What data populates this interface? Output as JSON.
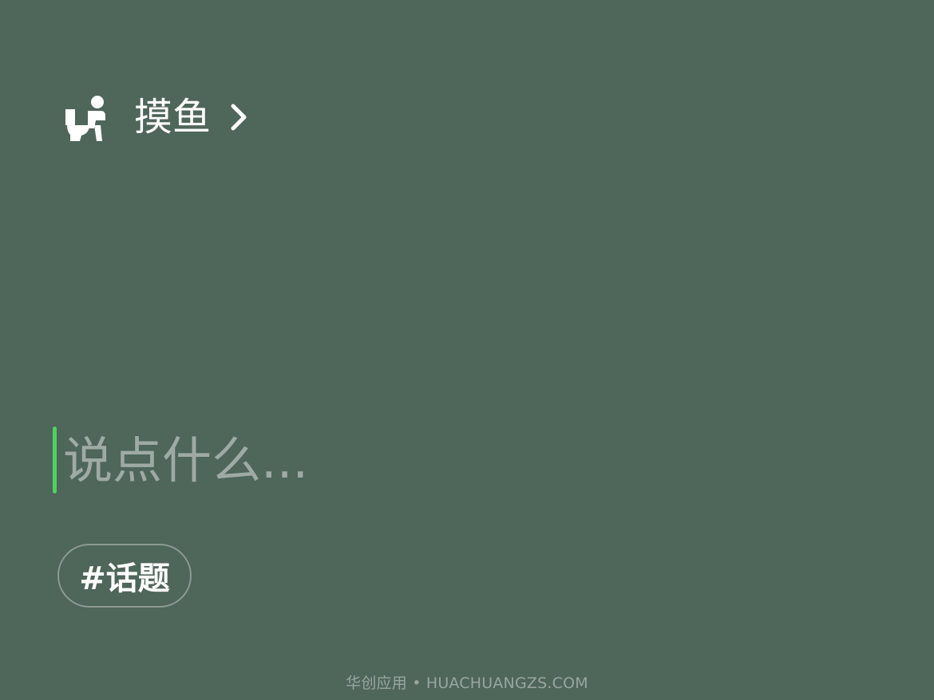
{
  "status": {
    "icon": "person-sitting-toilet-icon",
    "label": "摸鱼",
    "chevron": "chevron-right-icon"
  },
  "compose": {
    "placeholder": "说点什么...",
    "value": ""
  },
  "topic": {
    "label": "#话题"
  },
  "watermark": {
    "text": "华创应用 • HUACHUANGZS.COM"
  },
  "colors": {
    "background": "#4f665a",
    "caret": "#4cd35f",
    "text": "#ffffff"
  }
}
